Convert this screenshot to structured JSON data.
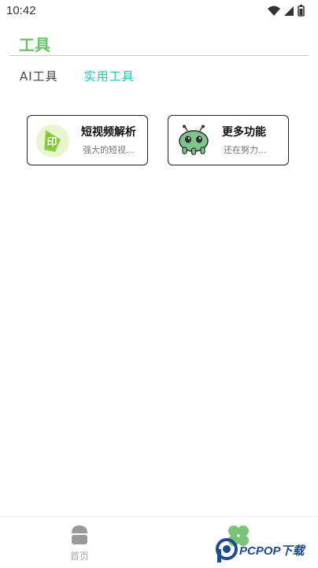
{
  "status_bar": {
    "time": "10:42",
    "icons": [
      "wifi-icon",
      "signal-icon",
      "battery-icon"
    ]
  },
  "header": {
    "title": "工具"
  },
  "tabs": [
    {
      "label": "AI工具",
      "active": false
    },
    {
      "label": "实用工具",
      "active": true
    }
  ],
  "cards": [
    {
      "title": "短视频解析",
      "subtitle": "强大的短视...",
      "icon": "video-parse-icon",
      "icon_text": "印"
    },
    {
      "title": "更多功能",
      "subtitle": "还在努力...",
      "icon": "robot-icon"
    }
  ],
  "bottom_nav": {
    "items": [
      {
        "label": "首页",
        "icon": "home-icon"
      },
      {
        "label": "",
        "icon": "clover-icon"
      }
    ]
  },
  "colors": {
    "title_green": "#6cc26a",
    "active_tab": "#29c2b5",
    "robot_green": "#7fc58d"
  },
  "watermark": {
    "logo": "pcpop-logo",
    "text": "PCPOP下载"
  }
}
